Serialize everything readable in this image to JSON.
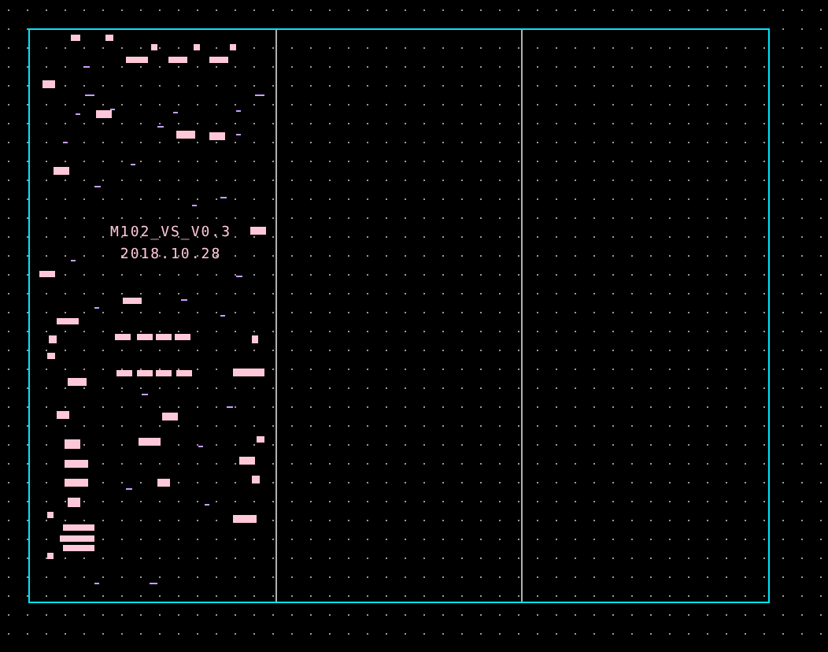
{
  "board_texts": [
    {
      "text": "M102_VS_V0.3"
    },
    {
      "text": "2018.10.28"
    }
  ]
}
